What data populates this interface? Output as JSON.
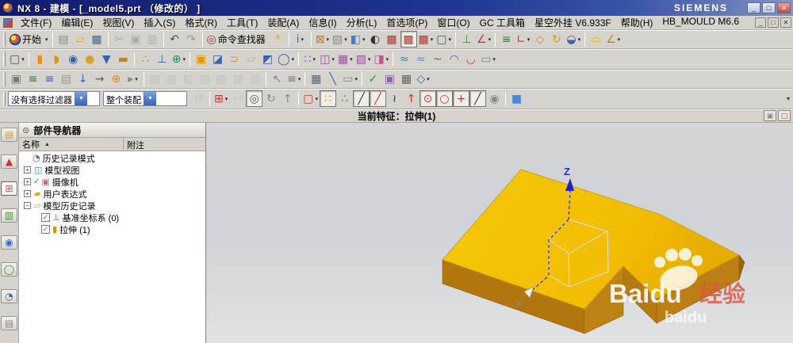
{
  "window": {
    "title": "NX 8 - 建模 - [_model5.prt （修改的） ]",
    "brand": "SIEMENS",
    "buttons": {
      "minimize": "_",
      "restore": "□",
      "close": "✕"
    }
  },
  "menu": {
    "items": [
      "文件(F)",
      "编辑(E)",
      "视图(V)",
      "插入(S)",
      "格式(R)",
      "工具(T)",
      "装配(A)",
      "信息(I)",
      "分析(L)",
      "首选项(P)",
      "窗口(O)",
      "GC 工具箱",
      "星空外挂 V6.933F",
      "帮助(H)",
      "HB_MOULD M6.6"
    ]
  },
  "toolbars": {
    "standard": [
      {
        "name": "start-button",
        "logo": true,
        "label": "开始",
        "arrow": true
      },
      {
        "sep": true
      },
      {
        "name": "new-file",
        "g": "▤",
        "c": "#7a8aa0"
      },
      {
        "name": "open-file",
        "g": "▱",
        "c": "#d9a02b"
      },
      {
        "name": "save-file",
        "g": "▦",
        "c": "#3a62b0"
      },
      {
        "sep": true
      },
      {
        "name": "cut",
        "g": "✂",
        "c": "#777",
        "gray": true
      },
      {
        "name": "copy",
        "g": "▣",
        "c": "#777",
        "gray": true
      },
      {
        "name": "paste",
        "g": "▥",
        "c": "#777",
        "gray": true
      },
      {
        "sep": true
      },
      {
        "name": "undo",
        "g": "↶",
        "c": "#555"
      },
      {
        "name": "redo",
        "g": "↷",
        "c": "#999"
      },
      {
        "sep": true
      },
      {
        "name": "command-finder",
        "g": "◎",
        "c": "#8a4040",
        "label": "命令查找器"
      },
      {
        "name": "user-assistant",
        "g": "*",
        "c": "#e0a818"
      },
      {
        "sep": true
      },
      {
        "name": "export-info",
        "g": "i",
        "c": "#2a6ad4",
        "arrow": true
      },
      {
        "sep": true
      },
      {
        "name": "fit-view",
        "g": "⊠",
        "c": "#e07020",
        "arrow": true
      },
      {
        "name": "zoom-view",
        "g": "▧",
        "c": "#8a8a8a",
        "arrow": true
      },
      {
        "name": "orient-view-cube",
        "g": "◧",
        "c": "#3f7cd6",
        "arrow": true
      },
      {
        "name": "render-style",
        "g": "◐",
        "c": "#333"
      },
      {
        "name": "wireframe-cube",
        "g": "▩",
        "c": "#b8382f"
      },
      {
        "name": "shaded-with-edges",
        "g": "▩",
        "c": "#b8382f",
        "pressed": true
      },
      {
        "name": "shaded-cube",
        "g": "▩",
        "c": "#b8382f",
        "arrow": true
      },
      {
        "name": "blank-view",
        "g": "▢",
        "c": "#555",
        "arrow": true
      },
      {
        "sep": true
      },
      {
        "name": "view-triad",
        "g": "⊥",
        "c": "#2a9a3a"
      },
      {
        "name": "view-section",
        "g": "∠",
        "c": "#cc3333",
        "arrow": true
      },
      {
        "sep": true
      },
      {
        "name": "layer-list",
        "g": "≡",
        "c": "#2e7d32"
      },
      {
        "name": "wcs-display",
        "g": "∟",
        "c": "#cc3333",
        "arrow": true
      },
      {
        "name": "move-object",
        "g": "◇",
        "c": "#d98a2b"
      },
      {
        "name": "rotate-object",
        "g": "↻",
        "c": "#c8a018"
      },
      {
        "name": "show-hide",
        "g": "◒",
        "c": "#3a62b0",
        "arrow": true
      },
      {
        "sep": true
      },
      {
        "name": "edge-display",
        "g": "▭",
        "c": "#d9b02b"
      },
      {
        "name": "angle-measure",
        "g": "∠",
        "c": "#c08030",
        "arrow": true
      }
    ],
    "feature": [
      {
        "name": "sketch",
        "g": "▢",
        "c": "#555",
        "arrow": true
      },
      {
        "sep": true
      },
      {
        "name": "extrude",
        "g": "▮",
        "c": "#e8900a"
      },
      {
        "name": "revolve",
        "g": "◗",
        "c": "#e8900a"
      },
      {
        "name": "hole",
        "g": "◉",
        "c": "#2f5fa8"
      },
      {
        "name": "boss",
        "g": "●",
        "c": "#d9a02b"
      },
      {
        "name": "pocket",
        "g": "▼",
        "c": "#3a62b0"
      },
      {
        "name": "pad",
        "g": "▬",
        "c": "#c8861a"
      },
      {
        "sep": true
      },
      {
        "name": "emboss",
        "g": "∴",
        "c": "#c08030"
      },
      {
        "name": "offset-emboss",
        "g": "⊥",
        "c": "#3a62b0"
      },
      {
        "name": "datum-plane",
        "g": "⊕",
        "c": "#2e8b57",
        "arrow": true
      },
      {
        "sep": true
      },
      {
        "name": "block",
        "g": "▣",
        "c": "#e8900a"
      },
      {
        "name": "thicken",
        "g": "◪",
        "c": "#3a62b0"
      },
      {
        "name": "bend",
        "g": "⊃",
        "c": "#e8900a"
      },
      {
        "name": "sheet-body",
        "g": "▱",
        "c": "#c8b060"
      },
      {
        "name": "bounded-plane",
        "g": "◩",
        "c": "#3a62b0"
      },
      {
        "name": "sphere",
        "g": "◯",
        "c": "#3a62b0",
        "arrow": true
      },
      {
        "sep": true
      },
      {
        "name": "pattern-feature",
        "g": "∷",
        "c": "#9a50a0",
        "arrow": true
      },
      {
        "name": "mirror-feature",
        "g": "◫",
        "c": "#9a50a0",
        "arrow": true
      },
      {
        "name": "pattern-face",
        "g": "▦",
        "c": "#9a50a0",
        "arrow": true
      },
      {
        "name": "delete-face",
        "g": "▧",
        "c": "#9a50a0",
        "arrow": true
      },
      {
        "name": "replace-face",
        "g": "◨",
        "c": "#c05890",
        "arrow": true
      },
      {
        "sep": true
      },
      {
        "name": "through-curves",
        "g": "≈",
        "c": "#3a7cd6"
      },
      {
        "name": "through-curve-mesh",
        "g": "≈",
        "c": "#5a8cd0"
      },
      {
        "name": "sweep-along-guide",
        "g": "~",
        "c": "#2a8a4a"
      },
      {
        "name": "section-surface",
        "g": "◠",
        "c": "#3a62b0"
      },
      {
        "name": "styled-sweep",
        "g": "◡",
        "c": "#cc3333"
      },
      {
        "name": "more-surface",
        "g": "▭",
        "c": "#888",
        "arrow": true
      }
    ],
    "utility": [
      {
        "name": "snapshot",
        "g": "▣",
        "c": "#7a7a7a"
      },
      {
        "name": "layer-stack",
        "g": "≡",
        "c": "#2e7d32"
      },
      {
        "name": "layer-settings",
        "g": "≡",
        "c": "#3a62b0"
      },
      {
        "name": "layer-category",
        "g": "▤",
        "c": "#999"
      },
      {
        "name": "move-to-layer",
        "g": "↓",
        "c": "#3a62b0"
      },
      {
        "name": "copy-to-layer",
        "g": "→",
        "c": "#2e7d32"
      },
      {
        "name": "wcs-dynamics",
        "g": "⊕",
        "c": "#d98a2b"
      },
      {
        "name": "wcs-more",
        "g": "▸",
        "c": "#888",
        "arrow": true
      },
      {
        "sep": true
      },
      {
        "name": "suppress-feature",
        "g": "▨",
        "c": "#aaa",
        "gray": true
      },
      {
        "name": "unsuppress-feature",
        "g": "▨",
        "c": "#aaa",
        "gray": true
      },
      {
        "name": "suppress-by-expression-1",
        "g": "▨",
        "c": "#aaa",
        "gray": true
      },
      {
        "name": "suppress-by-expression-2",
        "g": "▨",
        "c": "#aaa",
        "gray": true
      },
      {
        "name": "suppress-by-expression-3",
        "g": "▨",
        "c": "#aaa",
        "gray": true
      },
      {
        "name": "suppress-by-expression-4",
        "g": "▨",
        "c": "#aaa",
        "gray": true
      },
      {
        "name": "suppress-by-expression-5",
        "g": "▨",
        "c": "#aaa",
        "gray": true
      },
      {
        "sep": true
      },
      {
        "name": "direct-sketch",
        "g": "↖",
        "c": "#888"
      },
      {
        "name": "sketch-list",
        "g": "≡",
        "c": "#777",
        "arrow": true
      },
      {
        "sep": true
      },
      {
        "name": "expressions",
        "g": "▦",
        "c": "#3a62b0"
      },
      {
        "name": "tools-pen",
        "g": "╲",
        "c": "#3a62b0"
      },
      {
        "name": "macro",
        "g": "▭",
        "c": "#888",
        "arrow": true
      },
      {
        "sep": true
      },
      {
        "name": "examine-geometry",
        "g": "✓",
        "c": "#1d9a1d"
      },
      {
        "name": "part-quality",
        "g": "▣",
        "c": "#9060c0"
      },
      {
        "name": "report",
        "g": "▦",
        "c": "#3a62b0"
      },
      {
        "name": "geometry-check",
        "g": "◇",
        "c": "#3a62b0",
        "arrow": true
      }
    ],
    "selection_icons": [
      {
        "name": "previous-selection",
        "g": "↺",
        "c": "#aaa",
        "gray": true
      },
      {
        "sep": true
      },
      {
        "name": "general-selection-filter",
        "g": "⊞",
        "c": "#cc3333",
        "arrow": true
      },
      {
        "name": "restore-selection",
        "g": "↩",
        "c": "#aaa",
        "gray": true
      },
      {
        "name": "highlight-shaded",
        "g": "◎",
        "c": "#555",
        "pressed": true
      },
      {
        "name": "rotate-selection-cw",
        "g": "↻",
        "c": "#888"
      },
      {
        "name": "rotate-selection-up",
        "g": "↑",
        "c": "#888"
      },
      {
        "sep": true
      },
      {
        "name": "marquee-select",
        "g": "▢",
        "c": "#cc3333",
        "arrow": true
      },
      {
        "name": "snap-point-toggle",
        "g": "∷",
        "c": "#c89030",
        "pressed": true
      },
      {
        "name": "snap-end-point",
        "g": "∴",
        "c": "#2a9a3a"
      },
      {
        "name": "snap-mid-point",
        "g": "╱",
        "c": "#333",
        "pressed": true
      },
      {
        "name": "snap-control-point",
        "g": "╱",
        "c": "#cc3333",
        "pressed": true
      },
      {
        "name": "snap-intersection",
        "g": "≀",
        "c": "#333"
      },
      {
        "name": "snap-arc-center",
        "g": "↑",
        "c": "#cc3333"
      },
      {
        "name": "snap-quadrant-point",
        "g": "⊙",
        "c": "#cc3333",
        "pressed": true
      },
      {
        "name": "snap-existing-point",
        "g": "○",
        "c": "#cc3333",
        "pressed": true
      },
      {
        "name": "snap-point-on-curve",
        "g": "+",
        "c": "#cc3333",
        "pressed": true
      },
      {
        "name": "snap-point-on-surface",
        "g": "╱",
        "c": "#333",
        "pressed": true
      },
      {
        "name": "snap-bounded-grid",
        "g": "◉",
        "c": "#888"
      },
      {
        "sep": true
      },
      {
        "name": "shaded-solid-cube",
        "g": "■",
        "c": "#4a8ad4"
      }
    ]
  },
  "selection": {
    "filter_value": "没有选择过滤器",
    "scope_value": "整个装配"
  },
  "cue_bar": {
    "text": "当前特征：拉伸(1)",
    "right_buttons": [
      {
        "name": "cue-window-button",
        "g": "▣",
        "c": "#888"
      },
      {
        "name": "cue-fullscreen-button",
        "g": "▢",
        "c": "#cc3333"
      }
    ]
  },
  "resource_bar": {
    "tabs": [
      {
        "name": "assembly-navigator-tab",
        "g": "▤",
        "c": "#d9a02b"
      },
      {
        "name": "constraint-navigator-tab",
        "g": "▲",
        "c": "#cc3333"
      },
      {
        "name": "part-navigator-tab",
        "g": "⊞",
        "c": "#b05878",
        "selected": true
      },
      {
        "name": "reuse-library-tab",
        "g": "▥",
        "c": "#3a9a3a"
      },
      {
        "name": "hd3d-tools-tab",
        "g": "◉",
        "c": "#2a6ad4"
      },
      {
        "name": "web-browser-tab",
        "g": "◯",
        "c": "#2a9a3a"
      },
      {
        "name": "history-palette-tab",
        "g": "◔",
        "c": "#3a62b0"
      },
      {
        "name": "system-materials-tab",
        "g": "▤",
        "c": "#888"
      }
    ]
  },
  "navigator": {
    "title": "部件导航器",
    "col_name": "名称",
    "col_note": "附注",
    "rows": [
      {
        "name": "history-mode",
        "indent": 1,
        "icon": "clock-icon",
        "g": "◔",
        "c": "#3a62b0",
        "label": "历史记录模式"
      },
      {
        "name": "model-views",
        "expand": "+",
        "icon": "model-views-icon",
        "g": "◫",
        "c": "#2a8a8a",
        "label": "模型视图"
      },
      {
        "name": "cameras",
        "expand": "+",
        "check": true,
        "icon": "camera-icon",
        "g": "▣",
        "c": "#cc6688",
        "label": "摄像机"
      },
      {
        "name": "user-expressions",
        "expand": "+",
        "icon": "folder-icon",
        "g": "▰",
        "c": "#e0a818",
        "label": "用户表达式"
      },
      {
        "name": "model-history",
        "expand": "−",
        "icon": "folder-open-icon",
        "g": "▱",
        "c": "#e0a818",
        "label": "模型历史记录"
      },
      {
        "name": "datum-csys-0",
        "indent": 2,
        "checkbox": true,
        "icon": "datum-csys-icon",
        "g": "⊥",
        "c": "#cc4433",
        "label": "基准坐标系 (0)"
      },
      {
        "name": "extrude-1",
        "indent": 2,
        "checkbox": true,
        "icon": "extrude-icon",
        "g": "▮",
        "c": "#e8900a",
        "label": "拉伸 (1)"
      }
    ]
  },
  "viewport": {
    "axis_z": "Z",
    "axis_x": "X",
    "watermark": {
      "line1": "Baidu",
      "line1_cn": "经验",
      "line2": "baidu"
    },
    "colors": {
      "model_top": "#f5c404",
      "model_side": "#b1770e",
      "background_top": "#d3d5d8",
      "background_bottom": "#e0e2e4",
      "axis_blue": "#2a2ac0"
    }
  }
}
